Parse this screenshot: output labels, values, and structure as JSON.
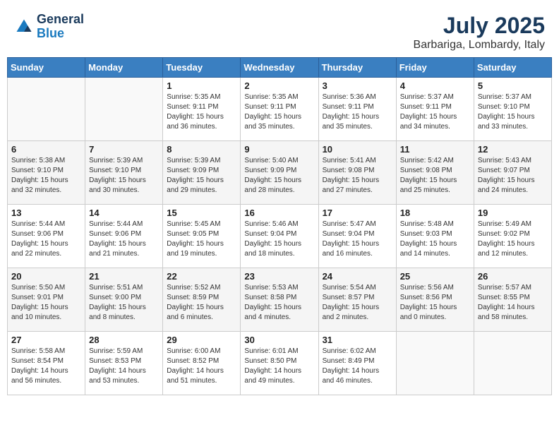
{
  "header": {
    "logo_line1": "General",
    "logo_line2": "Blue",
    "month": "July 2025",
    "location": "Barbariga, Lombardy, Italy"
  },
  "weekdays": [
    "Sunday",
    "Monday",
    "Tuesday",
    "Wednesday",
    "Thursday",
    "Friday",
    "Saturday"
  ],
  "weeks": [
    [
      {
        "day": "",
        "info": ""
      },
      {
        "day": "",
        "info": ""
      },
      {
        "day": "1",
        "info": "Sunrise: 5:35 AM\nSunset: 9:11 PM\nDaylight: 15 hours\nand 36 minutes."
      },
      {
        "day": "2",
        "info": "Sunrise: 5:35 AM\nSunset: 9:11 PM\nDaylight: 15 hours\nand 35 minutes."
      },
      {
        "day": "3",
        "info": "Sunrise: 5:36 AM\nSunset: 9:11 PM\nDaylight: 15 hours\nand 35 minutes."
      },
      {
        "day": "4",
        "info": "Sunrise: 5:37 AM\nSunset: 9:11 PM\nDaylight: 15 hours\nand 34 minutes."
      },
      {
        "day": "5",
        "info": "Sunrise: 5:37 AM\nSunset: 9:10 PM\nDaylight: 15 hours\nand 33 minutes."
      }
    ],
    [
      {
        "day": "6",
        "info": "Sunrise: 5:38 AM\nSunset: 9:10 PM\nDaylight: 15 hours\nand 32 minutes."
      },
      {
        "day": "7",
        "info": "Sunrise: 5:39 AM\nSunset: 9:10 PM\nDaylight: 15 hours\nand 30 minutes."
      },
      {
        "day": "8",
        "info": "Sunrise: 5:39 AM\nSunset: 9:09 PM\nDaylight: 15 hours\nand 29 minutes."
      },
      {
        "day": "9",
        "info": "Sunrise: 5:40 AM\nSunset: 9:09 PM\nDaylight: 15 hours\nand 28 minutes."
      },
      {
        "day": "10",
        "info": "Sunrise: 5:41 AM\nSunset: 9:08 PM\nDaylight: 15 hours\nand 27 minutes."
      },
      {
        "day": "11",
        "info": "Sunrise: 5:42 AM\nSunset: 9:08 PM\nDaylight: 15 hours\nand 25 minutes."
      },
      {
        "day": "12",
        "info": "Sunrise: 5:43 AM\nSunset: 9:07 PM\nDaylight: 15 hours\nand 24 minutes."
      }
    ],
    [
      {
        "day": "13",
        "info": "Sunrise: 5:44 AM\nSunset: 9:06 PM\nDaylight: 15 hours\nand 22 minutes."
      },
      {
        "day": "14",
        "info": "Sunrise: 5:44 AM\nSunset: 9:06 PM\nDaylight: 15 hours\nand 21 minutes."
      },
      {
        "day": "15",
        "info": "Sunrise: 5:45 AM\nSunset: 9:05 PM\nDaylight: 15 hours\nand 19 minutes."
      },
      {
        "day": "16",
        "info": "Sunrise: 5:46 AM\nSunset: 9:04 PM\nDaylight: 15 hours\nand 18 minutes."
      },
      {
        "day": "17",
        "info": "Sunrise: 5:47 AM\nSunset: 9:04 PM\nDaylight: 15 hours\nand 16 minutes."
      },
      {
        "day": "18",
        "info": "Sunrise: 5:48 AM\nSunset: 9:03 PM\nDaylight: 15 hours\nand 14 minutes."
      },
      {
        "day": "19",
        "info": "Sunrise: 5:49 AM\nSunset: 9:02 PM\nDaylight: 15 hours\nand 12 minutes."
      }
    ],
    [
      {
        "day": "20",
        "info": "Sunrise: 5:50 AM\nSunset: 9:01 PM\nDaylight: 15 hours\nand 10 minutes."
      },
      {
        "day": "21",
        "info": "Sunrise: 5:51 AM\nSunset: 9:00 PM\nDaylight: 15 hours\nand 8 minutes."
      },
      {
        "day": "22",
        "info": "Sunrise: 5:52 AM\nSunset: 8:59 PM\nDaylight: 15 hours\nand 6 minutes."
      },
      {
        "day": "23",
        "info": "Sunrise: 5:53 AM\nSunset: 8:58 PM\nDaylight: 15 hours\nand 4 minutes."
      },
      {
        "day": "24",
        "info": "Sunrise: 5:54 AM\nSunset: 8:57 PM\nDaylight: 15 hours\nand 2 minutes."
      },
      {
        "day": "25",
        "info": "Sunrise: 5:56 AM\nSunset: 8:56 PM\nDaylight: 15 hours\nand 0 minutes."
      },
      {
        "day": "26",
        "info": "Sunrise: 5:57 AM\nSunset: 8:55 PM\nDaylight: 14 hours\nand 58 minutes."
      }
    ],
    [
      {
        "day": "27",
        "info": "Sunrise: 5:58 AM\nSunset: 8:54 PM\nDaylight: 14 hours\nand 56 minutes."
      },
      {
        "day": "28",
        "info": "Sunrise: 5:59 AM\nSunset: 8:53 PM\nDaylight: 14 hours\nand 53 minutes."
      },
      {
        "day": "29",
        "info": "Sunrise: 6:00 AM\nSunset: 8:52 PM\nDaylight: 14 hours\nand 51 minutes."
      },
      {
        "day": "30",
        "info": "Sunrise: 6:01 AM\nSunset: 8:50 PM\nDaylight: 14 hours\nand 49 minutes."
      },
      {
        "day": "31",
        "info": "Sunrise: 6:02 AM\nSunset: 8:49 PM\nDaylight: 14 hours\nand 46 minutes."
      },
      {
        "day": "",
        "info": ""
      },
      {
        "day": "",
        "info": ""
      }
    ]
  ]
}
